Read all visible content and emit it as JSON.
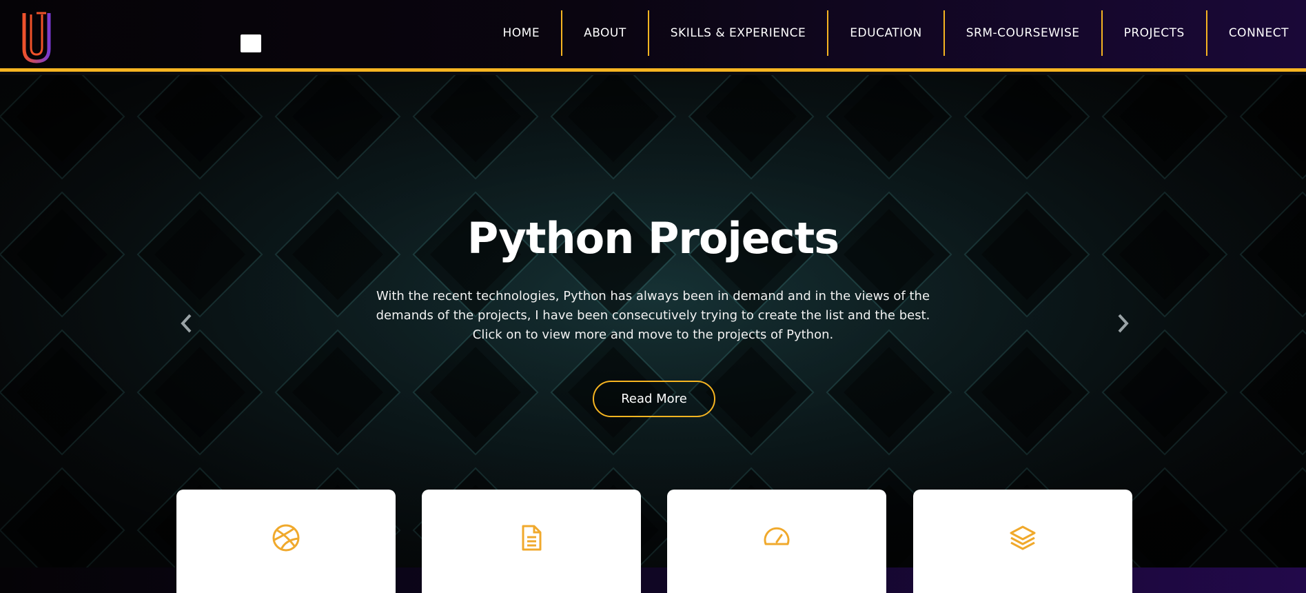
{
  "header": {
    "logo": "UJ",
    "menu_toggle": "menu-icon",
    "nav": [
      {
        "label": "HOME"
      },
      {
        "label": "ABOUT"
      },
      {
        "label": "SKILLS & EXPERIENCE"
      },
      {
        "label": "EDUCATION"
      },
      {
        "label": "SRM-COURSEWISE"
      },
      {
        "label": "PROJECTS"
      },
      {
        "label": "CONNECT"
      }
    ]
  },
  "hero": {
    "title": "Python Projects",
    "text": "With the recent technologies, Python has always been in demand and in the views of the demands of the projects, I have been consecutively trying to create the list and the best. Click on to view more and move to the projects of Python.",
    "button_label": "Read More",
    "prev_icon": "chevron-left-icon",
    "next_icon": "chevron-right-icon"
  },
  "cards": [
    {
      "icon": "dribbble-icon"
    },
    {
      "icon": "document-icon"
    },
    {
      "icon": "speedometer-icon"
    },
    {
      "icon": "layers-icon"
    }
  ],
  "colors": {
    "accent": "#f7b521",
    "header_dark": "#050306",
    "header_purple": "#1a0838",
    "hero_teal": "#163235",
    "card_bg": "#ffffff"
  }
}
